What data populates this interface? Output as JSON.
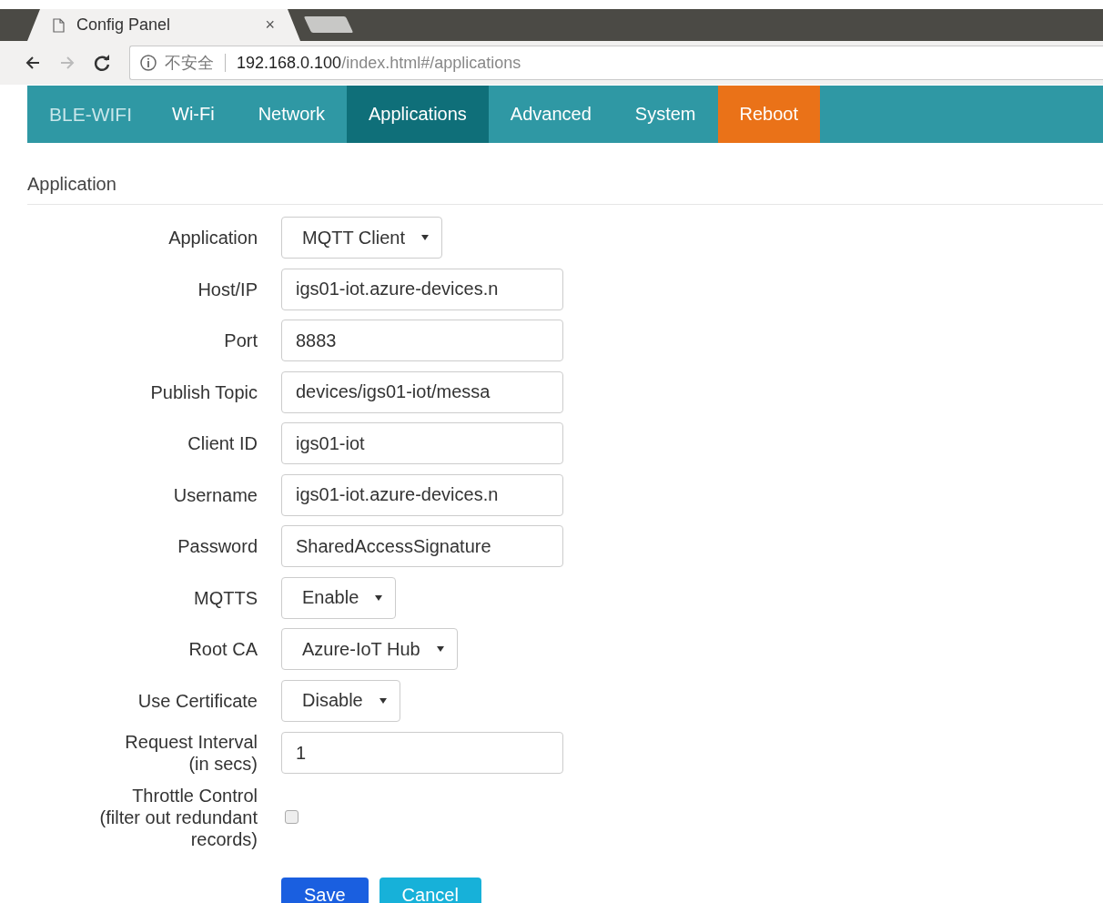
{
  "browser": {
    "tab": {
      "title": "Config Panel",
      "close": "×"
    },
    "address": {
      "security": "不安全",
      "host": "192.168.0.100",
      "path": "/index.html#/applications"
    }
  },
  "navbar": {
    "brand": "BLE-WIFI",
    "items": [
      {
        "label": "Wi-Fi",
        "selected": false,
        "kind": "link"
      },
      {
        "label": "Network",
        "selected": false,
        "kind": "link"
      },
      {
        "label": "Applications",
        "selected": true,
        "kind": "link"
      },
      {
        "label": "Advanced",
        "selected": false,
        "kind": "link"
      },
      {
        "label": "System",
        "selected": false,
        "kind": "link"
      },
      {
        "label": "Reboot",
        "selected": false,
        "kind": "action"
      }
    ]
  },
  "section_title": "Application",
  "form": [
    {
      "label": "Application",
      "kind": "select",
      "value": "MQTT Client"
    },
    {
      "label": "Host/IP",
      "kind": "input",
      "value": "igs01-iot.azure-devices.n"
    },
    {
      "label": "Port",
      "kind": "input",
      "value": "8883"
    },
    {
      "label": "Publish Topic",
      "kind": "input",
      "value": "devices/igs01-iot/messa"
    },
    {
      "label": "Client ID",
      "kind": "input",
      "value": "igs01-iot"
    },
    {
      "label": "Username",
      "kind": "input",
      "value": "igs01-iot.azure-devices.n"
    },
    {
      "label": "Password",
      "kind": "input",
      "value": "SharedAccessSignature"
    },
    {
      "label": "MQTTS",
      "kind": "select",
      "value": "Enable"
    },
    {
      "label": "Root CA",
      "kind": "select",
      "value": "Azure-IoT Hub"
    },
    {
      "label": "Use Certificate",
      "kind": "select",
      "value": "Disable"
    },
    {
      "label": "Request Interval\n(in secs)",
      "kind": "input",
      "value": "1"
    },
    {
      "label": "Throttle Control\n(filter out redundant\nrecords)",
      "kind": "checkbox",
      "checked": false
    }
  ],
  "buttons": [
    {
      "label": "Save",
      "kind": "primary"
    },
    {
      "label": "Cancel",
      "kind": "info"
    }
  ]
}
